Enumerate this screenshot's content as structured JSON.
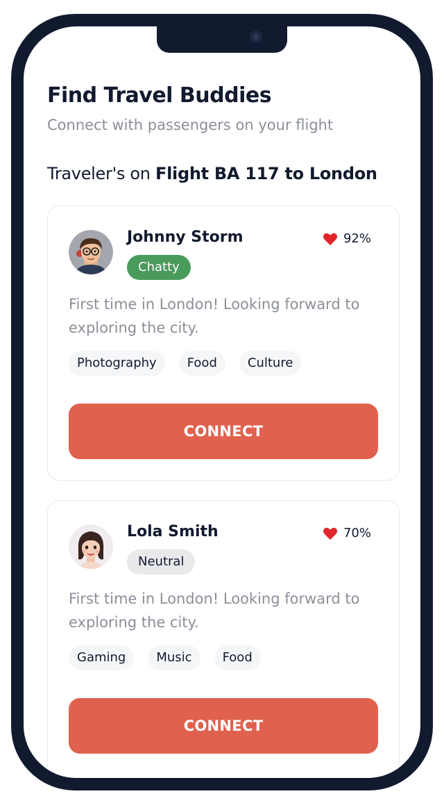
{
  "header": {
    "title": "Find Travel Buddies",
    "subtitle": "Connect with passengers on your flight",
    "flight_prefix": "Traveler's on ",
    "flight_name": "Flight BA 117 to London"
  },
  "colors": {
    "primary": "#e0624e",
    "chatty": "#4a9a5c",
    "neutral": "#e9e9ec",
    "heart": "#e3262b",
    "frame": "#111a2e"
  },
  "travelers": [
    {
      "name": "Johnny Storm",
      "match": "92%",
      "mood": "Chatty",
      "bio": "First time in London! Looking forward to exploring the city.",
      "tags": [
        "Photography",
        "Food",
        "Culture"
      ],
      "button": "CONNECT",
      "avatar_icon": "avatar-boy-glasses-icon"
    },
    {
      "name": "Lola Smith",
      "match": "70%",
      "mood": "Neutral",
      "bio": "First time in London! Looking forward to exploring the city.",
      "tags": [
        "Gaming",
        "Music",
        "Food"
      ],
      "button": "CONNECT",
      "avatar_icon": "avatar-girl-icon"
    }
  ]
}
